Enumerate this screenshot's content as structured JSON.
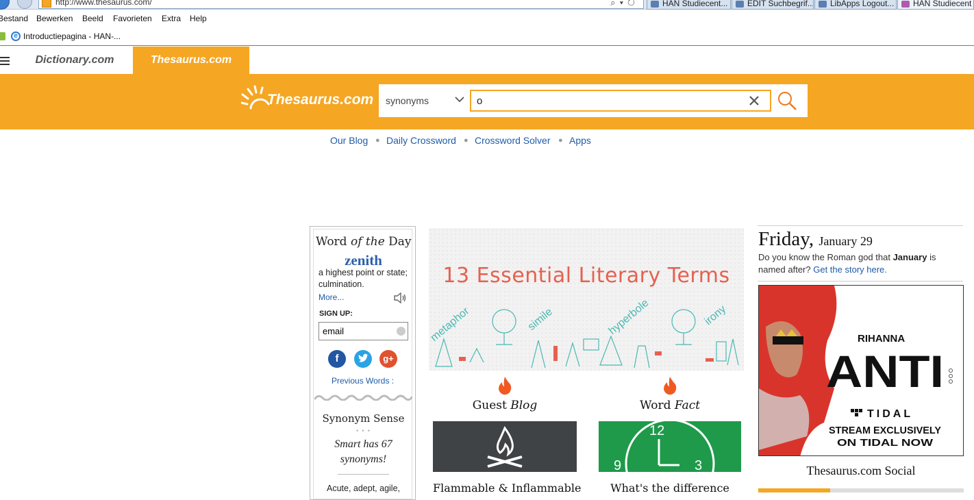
{
  "browser": {
    "address": "http://www.thesaurus.com/",
    "tabs": [
      {
        "label": "HAN Studiecent..."
      },
      {
        "label": "EDIT Suchbegrif..."
      },
      {
        "label": "LibApps Logout..."
      },
      {
        "label": "HAN Studiecent"
      }
    ],
    "menu": [
      "Bestand",
      "Bewerken",
      "Beeld",
      "Favorieten",
      "Extra",
      "Help"
    ],
    "favorites": [
      "Introductiepagina - HAN-..."
    ]
  },
  "site_tabs": {
    "dictionary": "Dictionary.com",
    "thesaurus": "Thesaurus.com"
  },
  "header": {
    "logo_text": "Thesaurus.com",
    "search_type": "synonyms",
    "search_value": "o",
    "accent_color": "#f5a623"
  },
  "subnav": [
    "Our Blog",
    "Daily Crossword",
    "Crossword Solver",
    "Apps"
  ],
  "wotd": {
    "title_prefix": "Word",
    "title_mid": "of the",
    "title_suffix": "Day",
    "word": "zenith",
    "definition": "a highest point or state; culmination.",
    "more": "More...",
    "signup": "SIGN UP:",
    "email_value": "email",
    "previous": "Previous Words :",
    "synonym_sense": "Synonym Sense",
    "synonym_text": "Smart has 67 synonyms!",
    "synonym_list": "Acute, adept, agile,"
  },
  "feature": {
    "title": "13 Essential Literary Terms",
    "art_words": [
      "metaphor",
      "simile",
      "hyperbole",
      "irony"
    ]
  },
  "columns": [
    {
      "label_a": "Guest",
      "label_b": "Blog",
      "caption": "Flammable & Inflammable"
    },
    {
      "label_a": "Word",
      "label_b": "Fact",
      "caption": "What's the difference"
    }
  ],
  "clock_numbers": [
    "12",
    "9",
    "3"
  ],
  "right": {
    "day": "Friday,",
    "date": "January 29",
    "dyk_1": "Do you know the Roman god that",
    "dyk_bold": "January",
    "dyk_2": "is named after?",
    "dyk_link": "Get the story here.",
    "ad_artist": "RIHANNA",
    "ad_album": "ANTI",
    "ad_brand": "TIDAL",
    "ad_line1": "STREAM EXCLUSIVELY",
    "ad_line2": "ON TIDAL NOW",
    "social_heading": "Thesaurus.com Social"
  }
}
